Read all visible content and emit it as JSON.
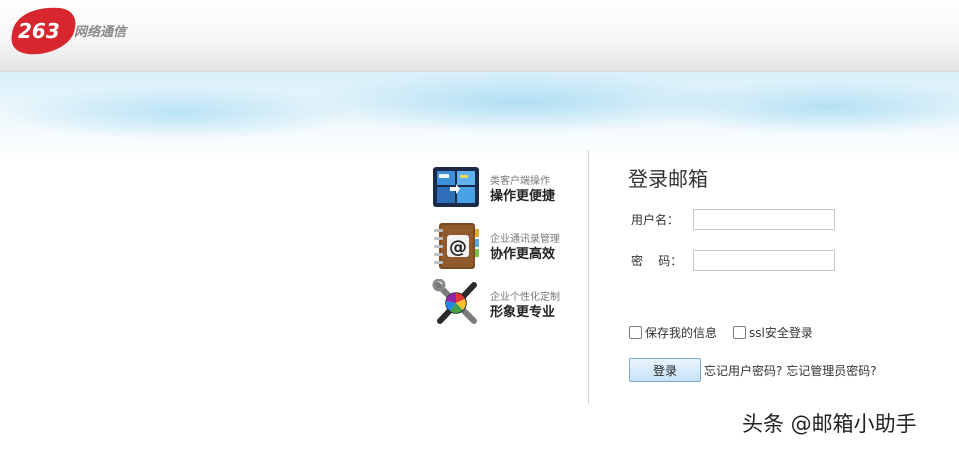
{
  "header": {
    "logo_number": "263",
    "logo_text": "网络通信"
  },
  "features": [
    {
      "sub": "类客户端操作",
      "title": "操作更便捷",
      "icon": "windows-tiles-icon"
    },
    {
      "sub": "企业通讯录管理",
      "title": "协作更高效",
      "icon": "address-book-icon"
    },
    {
      "sub": "企业个性化定制",
      "title": "形象更专业",
      "icon": "tools-palette-icon"
    }
  ],
  "login": {
    "title": "登录邮箱",
    "username_label": "用户名：",
    "username_value": "",
    "password_label": "密    码：",
    "password_value": "",
    "save_info_label": "保存我的信息",
    "ssl_label": "ssl安全登录",
    "login_button": "登录",
    "forgot_user_password": "忘记用户密码?",
    "forgot_admin_password": "忘记管理员密码?"
  },
  "watermark": "头条 @邮箱小助手",
  "colors": {
    "logo_red": "#d7262d",
    "button_bg": "#c6e2f6",
    "button_border": "#7fa9c9"
  }
}
